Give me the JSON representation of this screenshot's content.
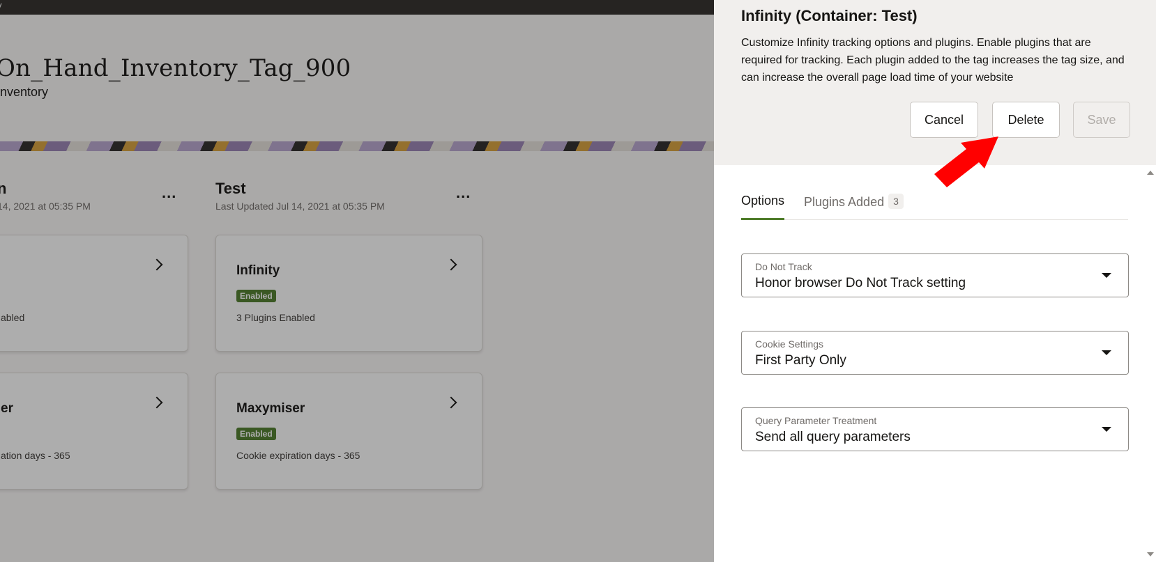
{
  "background": {
    "topbar_text": "y",
    "page_title": "On_Hand_Inventory_Tag_900",
    "page_subtitle": "inventory",
    "columns": [
      {
        "title": "n",
        "updated": "14, 2021 at 05:35 PM",
        "more_label": "...",
        "cards": [
          {
            "title": "",
            "badge": "",
            "desc": "abled"
          },
          {
            "title": "er",
            "badge": "",
            "desc": "ation days - 365"
          }
        ]
      },
      {
        "title": "Test",
        "updated": "Last Updated Jul 14, 2021 at 05:35 PM",
        "more_label": "...",
        "cards": [
          {
            "title": "Infinity",
            "badge": "Enabled",
            "desc": "3 Plugins Enabled"
          },
          {
            "title": "Maxymiser",
            "badge": "Enabled",
            "desc": "Cookie expiration days - 365"
          }
        ]
      }
    ]
  },
  "drawer": {
    "title": "Infinity (Container: Test)",
    "description": "Customize Infinity tracking options and plugins. Enable plugins that are required for tracking. Each plugin added to the tag increases the tag size, and can increase the overall page load time of your website",
    "buttons": {
      "cancel": "Cancel",
      "delete": "Delete",
      "save": "Save"
    },
    "tabs": [
      {
        "label": "Options",
        "active": true
      },
      {
        "label": "Plugins Added",
        "count": "3",
        "active": false
      }
    ],
    "fields": [
      {
        "label": "Do Not Track",
        "value": "Honor browser Do Not Track setting"
      },
      {
        "label": "Cookie Settings",
        "value": "First Party Only"
      },
      {
        "label": "Query Parameter Treatment",
        "value": "Send all query parameters"
      }
    ]
  },
  "colors": {
    "accent_green": "#4f7d2b",
    "annotation_arrow": "#ff0000",
    "topbar": "#312d2a"
  }
}
